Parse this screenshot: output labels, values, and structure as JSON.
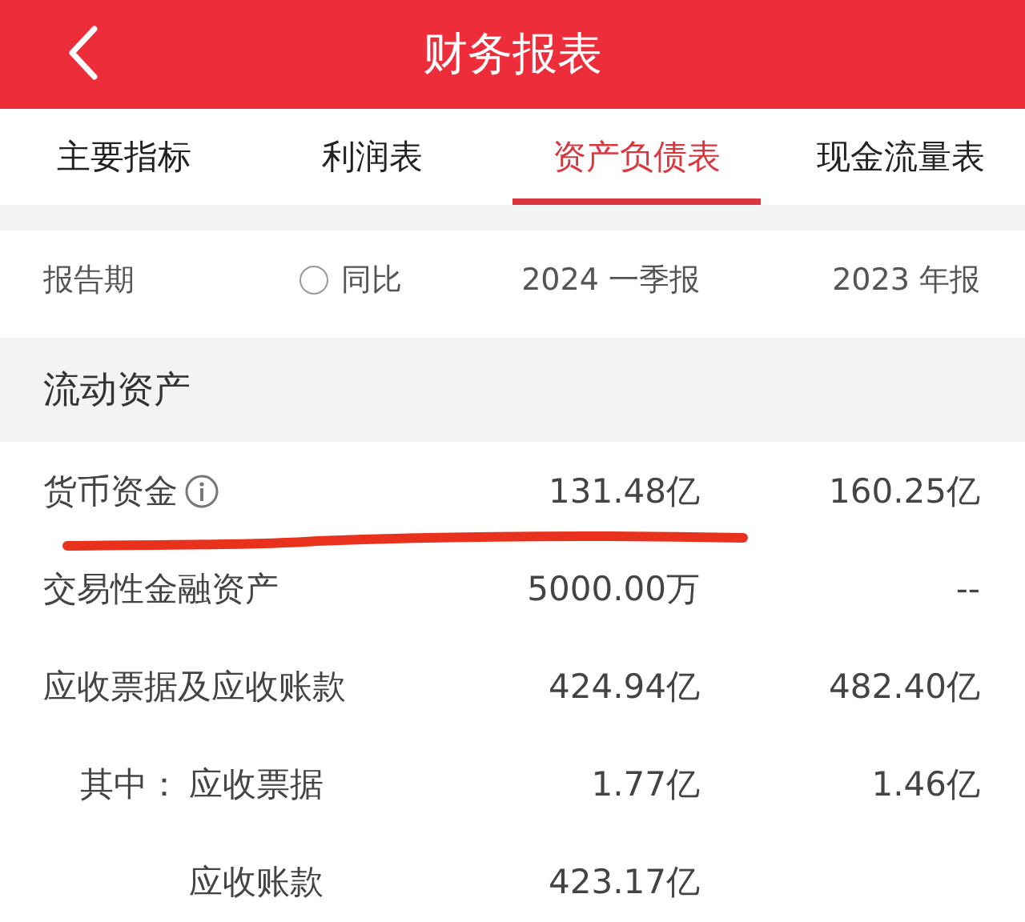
{
  "header": {
    "title": "财务报表"
  },
  "tabs": [
    {
      "label": "主要指标",
      "selected": false
    },
    {
      "label": "利润表",
      "selected": false
    },
    {
      "label": "资产负债表",
      "selected": true
    },
    {
      "label": "现金流量表",
      "selected": false
    }
  ],
  "period_row": {
    "label": "报告期",
    "yoy": {
      "label": "同比",
      "checked": false
    },
    "columns": [
      "2024 一季报",
      "2023 年报"
    ]
  },
  "section": {
    "title": "流动资产"
  },
  "rows": [
    {
      "label": "货币资金",
      "info": true,
      "marked": true,
      "values": [
        "131.48亿",
        "160.25亿"
      ]
    },
    {
      "label": "交易性金融资产",
      "values": [
        "5000.00万",
        "--"
      ]
    },
    {
      "label": "应收票据及应收账款",
      "values": [
        "424.94亿",
        "482.40亿"
      ],
      "children": [
        {
          "prefix": "其中：",
          "label": "应收票据",
          "values": [
            "1.77亿",
            "1.46亿"
          ]
        },
        {
          "label": "应收账款",
          "values": [
            "423.17亿"
          ]
        }
      ]
    }
  ]
}
